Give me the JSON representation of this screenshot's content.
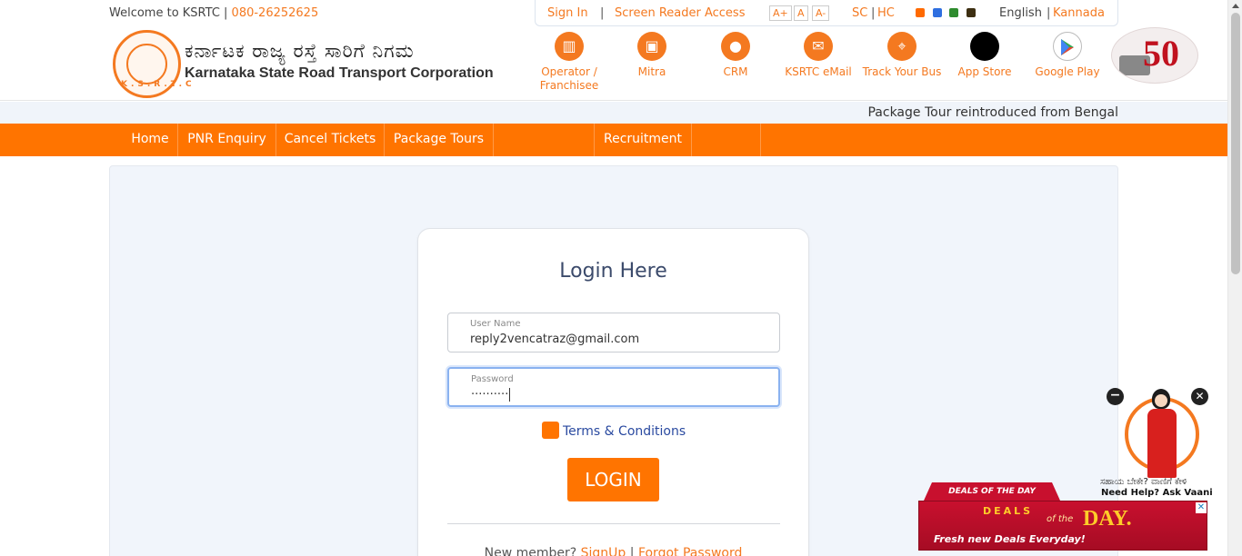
{
  "header": {
    "welcome_text": "Welcome to KSRTC | ",
    "phone": "080-26252625",
    "access": {
      "sign_in": "Sign In",
      "divider": "|",
      "screen_reader": "Screen Reader Access",
      "font_increase": "A+",
      "font_normal": "A",
      "font_decrease": "A-",
      "sc": "SC",
      "pipe": "|",
      "hc": "HC",
      "theme_colors": [
        "#ff6a00",
        "#2f6fe0",
        "#2e8b2e",
        "#3d2f12"
      ],
      "lang_english": "English",
      "lang_sep": "|",
      "lang_kannada": "Kannada"
    },
    "org_name_kannada": "ಕರ್ನಾಟಕ ರಾಜ್ಯ ರಸ್ತೆ ಸಾರಿಗೆ ನಿಗಮ",
    "org_name_english": "Karnataka State Road Transport Corporation",
    "logo_letters": "K.S.R.T.C",
    "quick_links": [
      {
        "label": "Operator / Franchisee",
        "icon": "chart-icon"
      },
      {
        "label": "Mitra",
        "icon": "bus-icon"
      },
      {
        "label": "CRM",
        "icon": "user-icon"
      },
      {
        "label": "KSRTC eMail",
        "icon": "mail-icon"
      },
      {
        "label": "Track Your Bus",
        "icon": "location-icon"
      },
      {
        "label": "App Store",
        "icon": "apple-icon"
      },
      {
        "label": "Google Play",
        "icon": "google-play-icon"
      }
    ]
  },
  "ticker": {
    "text": "Package Tour reintroduced from Bengal"
  },
  "nav": {
    "items": [
      "Home",
      "PNR Enquiry",
      "Cancel Tickets",
      "Package Tours",
      "",
      "Recruitment",
      ""
    ]
  },
  "login": {
    "title": "Login Here",
    "username_label": "User Name",
    "username_value": "reply2vencatraz@gmail.com",
    "password_label": "Password",
    "password_value": "··········",
    "terms_label": "Terms & Conditions",
    "login_button": "LOGIN",
    "new_member_text": "New member?",
    "signup_link": "SignUp",
    "sep": "|",
    "forgot_link": "Forgot Password"
  },
  "vaani": {
    "minimize": "−",
    "close": "✕",
    "kannada_text": "ಸಹಾಯ ಬೇಕೇ? ವಾಣಿಗೆ ಕೇಳಿ",
    "english_text": "Need Help? Ask Vaani"
  },
  "ad": {
    "ribbon": "DEALS OF THE DAY",
    "deals": "DEALS",
    "of_the": "of the",
    "day": "DAY.",
    "tagline": "Fresh new Deals Everyday!",
    "close": "✕"
  },
  "colors": {
    "brand_orange": "#ff7400",
    "link_orange": "#f47920",
    "terms_blue": "#2a4aa0"
  }
}
